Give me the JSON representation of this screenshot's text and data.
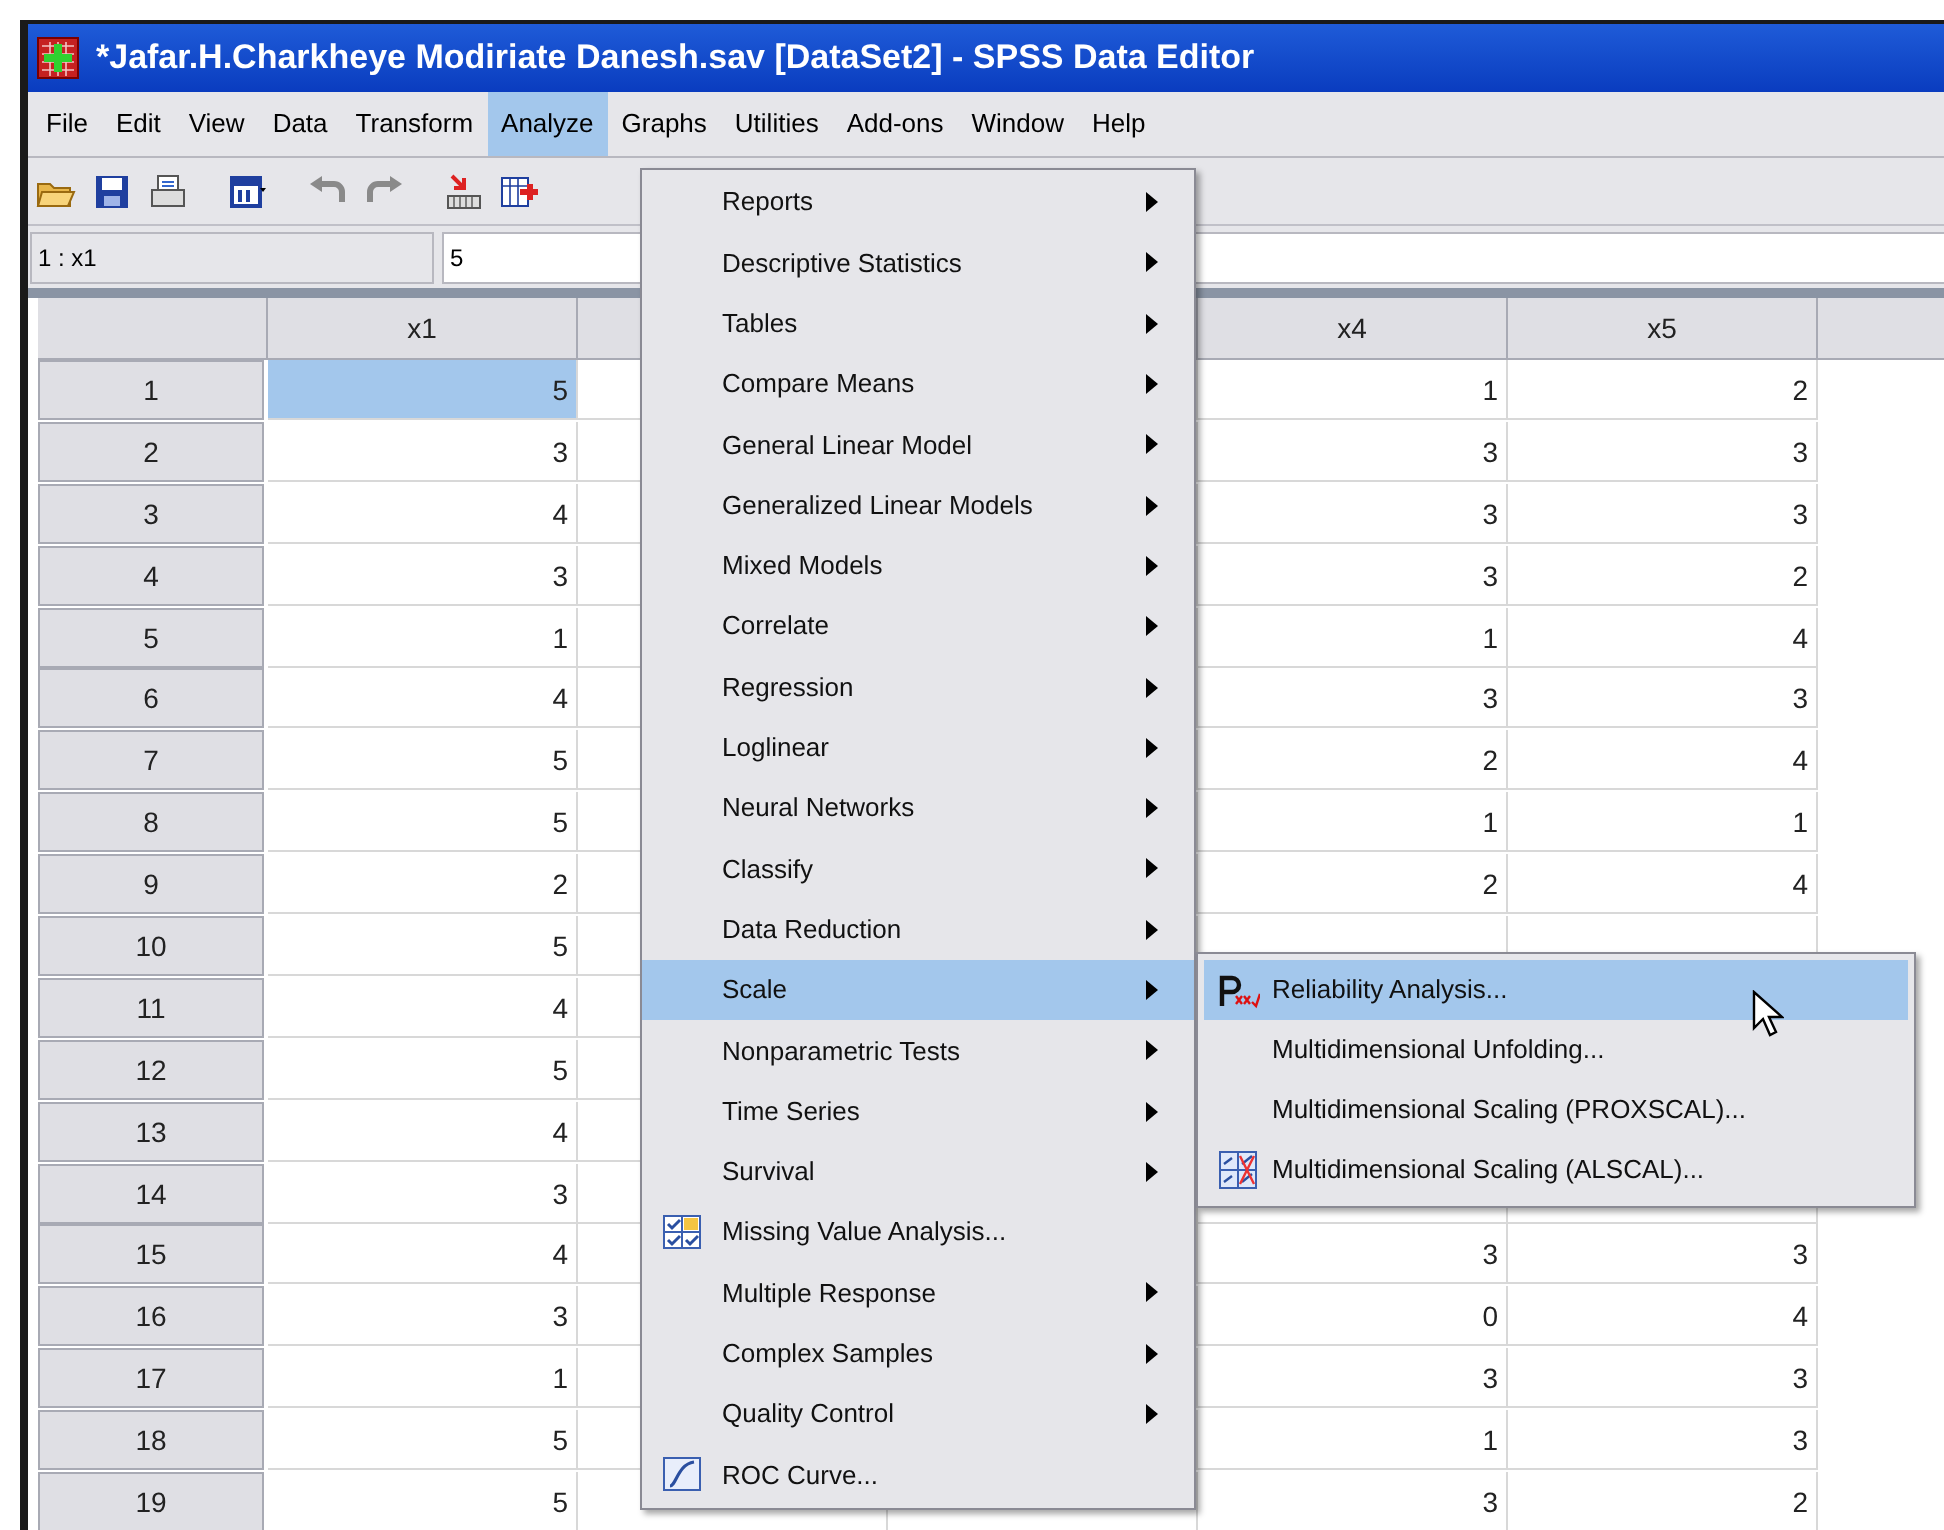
{
  "window": {
    "title": "*Jafar.H.Charkheye Modiriate Danesh.sav [DataSet2] - SPSS Data Editor"
  },
  "menu_bar": [
    {
      "label": "File",
      "selected": false
    },
    {
      "label": "Edit",
      "selected": false
    },
    {
      "label": "View",
      "selected": false
    },
    {
      "label": "Data",
      "selected": false
    },
    {
      "label": "Transform",
      "selected": false
    },
    {
      "label": "Analyze",
      "selected": true
    },
    {
      "label": "Graphs",
      "selected": false
    },
    {
      "label": "Utilities",
      "selected": false
    },
    {
      "label": "Add-ons",
      "selected": false
    },
    {
      "label": "Window",
      "selected": false
    },
    {
      "label": "Help",
      "selected": false
    }
  ],
  "cell_editor": {
    "reference": "1 : x1",
    "value": "5"
  },
  "grid": {
    "columns": [
      "x1",
      "x4",
      "x5"
    ],
    "rows": [
      {
        "number": "1",
        "cells": [
          "5",
          "1",
          "2"
        ],
        "selected": true
      },
      {
        "number": "2",
        "cells": [
          "3",
          "3",
          "3"
        ],
        "selected": false
      },
      {
        "number": "3",
        "cells": [
          "4",
          "3",
          "3"
        ],
        "selected": false
      },
      {
        "number": "4",
        "cells": [
          "3",
          "3",
          "2"
        ],
        "selected": false
      },
      {
        "number": "5",
        "cells": [
          "1",
          "1",
          "4"
        ],
        "selected": false
      },
      {
        "number": "6",
        "cells": [
          "4",
          "3",
          "3"
        ],
        "selected": false
      },
      {
        "number": "7",
        "cells": [
          "5",
          "2",
          "4"
        ],
        "selected": false
      },
      {
        "number": "8",
        "cells": [
          "5",
          "1",
          "1"
        ],
        "selected": false
      },
      {
        "number": "9",
        "cells": [
          "2",
          "2",
          "4"
        ],
        "selected": false
      },
      {
        "number": "10",
        "cells": [
          "5",
          null,
          null
        ],
        "selected": false
      },
      {
        "number": "11",
        "cells": [
          "4",
          null,
          null
        ],
        "selected": false
      },
      {
        "number": "12",
        "cells": [
          "5",
          null,
          null
        ],
        "selected": false
      },
      {
        "number": "13",
        "cells": [
          "4",
          null,
          null
        ],
        "selected": false
      },
      {
        "number": "14",
        "cells": [
          "3",
          null,
          null
        ],
        "selected": false
      },
      {
        "number": "15",
        "cells": [
          "4",
          "3",
          "3"
        ],
        "selected": false
      },
      {
        "number": "16",
        "cells": [
          "3",
          "0",
          "4"
        ],
        "selected": false
      },
      {
        "number": "17",
        "cells": [
          "1",
          "3",
          "3"
        ],
        "selected": false
      },
      {
        "number": "18",
        "cells": [
          "5",
          "1",
          "3"
        ],
        "selected": false
      },
      {
        "number": "19",
        "cells": [
          "5",
          "3",
          "2"
        ],
        "selected": false
      }
    ]
  },
  "analyze_menu": {
    "items": [
      {
        "label": "Reports",
        "kind": "submenu",
        "selected": false
      },
      {
        "label": "Descriptive Statistics",
        "kind": "submenu",
        "selected": false
      },
      {
        "label": "Tables",
        "kind": "submenu",
        "selected": false
      },
      {
        "label": "Compare Means",
        "kind": "submenu",
        "selected": false
      },
      {
        "label": "General Linear Model",
        "kind": "submenu",
        "selected": false
      },
      {
        "label": "Generalized Linear Models",
        "kind": "submenu",
        "selected": false
      },
      {
        "label": "Mixed Models",
        "kind": "submenu",
        "selected": false
      },
      {
        "label": "Correlate",
        "kind": "submenu",
        "selected": false
      },
      {
        "label": "Regression",
        "kind": "submenu",
        "selected": false
      },
      {
        "label": "Loglinear",
        "kind": "submenu",
        "selected": false
      },
      {
        "label": "Neural Networks",
        "kind": "submenu",
        "selected": false
      },
      {
        "label": "Classify",
        "kind": "submenu",
        "selected": false
      },
      {
        "label": "Data Reduction",
        "kind": "submenu",
        "selected": false
      },
      {
        "label": "Scale",
        "kind": "submenu",
        "selected": true
      },
      {
        "label": "Nonparametric Tests",
        "kind": "submenu",
        "selected": false
      },
      {
        "label": "Time Series",
        "kind": "submenu",
        "selected": false
      },
      {
        "label": "Survival",
        "kind": "submenu",
        "selected": false
      },
      {
        "label": "Missing Value Analysis...",
        "kind": "command",
        "selected": false
      },
      {
        "label": "Multiple Response",
        "kind": "submenu",
        "selected": false
      },
      {
        "label": "Complex Samples",
        "kind": "submenu",
        "selected": false
      },
      {
        "label": "Quality Control",
        "kind": "submenu",
        "selected": false
      },
      {
        "label": "ROC Curve...",
        "kind": "command",
        "selected": false
      }
    ]
  },
  "scale_submenu": {
    "items": [
      {
        "label": "Reliability Analysis...",
        "selected": true
      },
      {
        "label": "Multidimensional Unfolding...",
        "selected": false
      },
      {
        "label": "Multidimensional Scaling (PROXSCAL)...",
        "selected": false
      },
      {
        "label": "Multidimensional Scaling (ALSCAL)...",
        "selected": false
      }
    ]
  }
}
